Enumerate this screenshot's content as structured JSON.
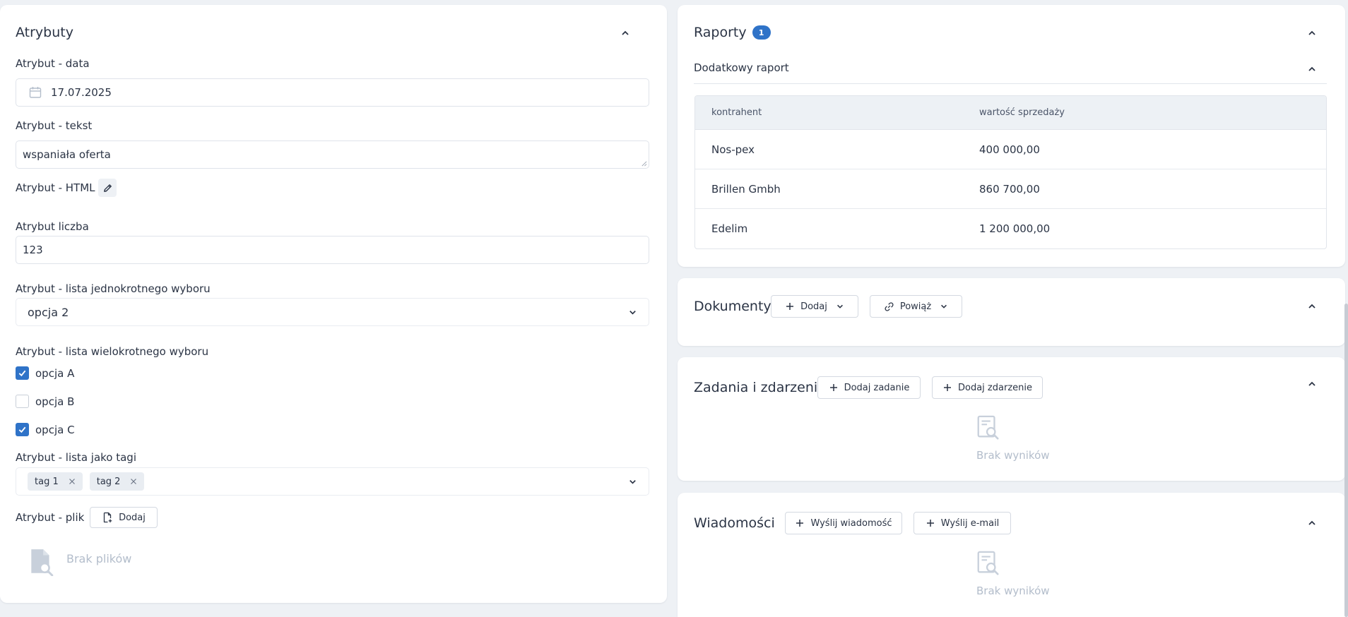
{
  "attributes": {
    "title": "Atrybuty",
    "date_label": "Atrybut - data",
    "date_value": "17.07.2025",
    "text_label": "Atrybut - tekst",
    "text_value": "wspaniała oferta",
    "html_label": "Atrybut - HTML",
    "number_label": "Atrybut liczba",
    "number_value": "123",
    "single_label": "Atrybut - lista jednokrotnego wyboru",
    "single_value": "opcja 2",
    "multi_label": "Atrybut - lista wielokrotnego wyboru",
    "multi_options": [
      {
        "label": "opcja A",
        "checked": true
      },
      {
        "label": "opcja B",
        "checked": false
      },
      {
        "label": "opcja C",
        "checked": true
      }
    ],
    "tags_label": "Atrybut - lista jako tagi",
    "tags": [
      "tag 1",
      "tag 2"
    ],
    "file_label": "Atrybut - plik",
    "file_add": "Dodaj",
    "file_empty": "Brak plików"
  },
  "reports": {
    "title": "Raporty",
    "badge": "1",
    "sub_title": "Dodatkowy raport",
    "columns": [
      "kontrahent",
      "wartość sprzedaży"
    ],
    "rows": [
      [
        "Nos-pex",
        "400 000,00"
      ],
      [
        "Brillen Gmbh",
        "860 700,00"
      ],
      [
        "Edelim",
        "1 200 000,00"
      ]
    ]
  },
  "documents": {
    "title": "Dokumenty",
    "add": "Dodaj",
    "link": "Powiąż"
  },
  "tasks": {
    "title": "Zadania i zdarzenia",
    "add_task": "Dodaj zadanie",
    "add_event": "Dodaj zdarzenie",
    "empty": "Brak wyników"
  },
  "messages": {
    "title": "Wiadomości",
    "send_message": "Wyślij wiadomość",
    "send_email": "Wyślij e-mail",
    "empty": "Brak wyników"
  },
  "colors": {
    "accent": "#2f73c8",
    "background": "#eef1f5",
    "muted": "#b3bdcb"
  }
}
